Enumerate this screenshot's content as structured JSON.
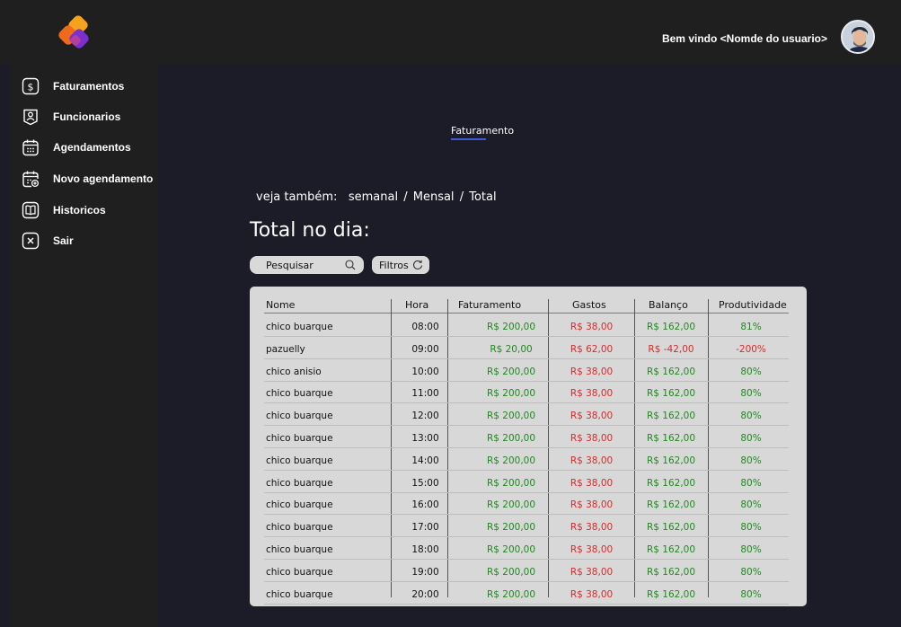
{
  "header": {
    "welcome": "Bem vindo <Nomde do usuario>"
  },
  "colors": {
    "background": "#1c1c28",
    "panel": "#1f1f1f",
    "accent": "#3d5bd9",
    "positive": "#1f8a1f",
    "negative": "#d62b2b",
    "logo_orange": "#f08a1c",
    "logo_purple": "#7b2fd1"
  },
  "sidebar": {
    "items": [
      {
        "label": "Faturamentos",
        "icon": "dollar-icon"
      },
      {
        "label": "Funcionarios",
        "icon": "user-badge-icon"
      },
      {
        "label": "Agendamentos",
        "icon": "calendar-icon"
      },
      {
        "label": "Novo agendamento",
        "icon": "calendar-add-icon"
      },
      {
        "label": "Historicos",
        "icon": "book-icon"
      },
      {
        "label": "Sair",
        "icon": "close-icon"
      }
    ]
  },
  "tabs": {
    "active": "Faturamento"
  },
  "see_also": {
    "prefix": "veja também:",
    "links": [
      "semanal",
      "Mensal",
      "Total"
    ],
    "separator": "/"
  },
  "main": {
    "title": "Total no dia:"
  },
  "search": {
    "placeholder": "Pesquisar"
  },
  "filters": {
    "label": "Filtros"
  },
  "table": {
    "headers": [
      "Nome",
      "Hora",
      "Faturamento",
      "Gastos",
      "Balanço",
      "Produtividade"
    ],
    "rows": [
      {
        "nome": "chico buarque",
        "hora": "08:00",
        "faturamento": "R$ 200,00",
        "gastos": "R$ 38,00",
        "balanco": "R$ 162,00",
        "produtividade": "81%"
      },
      {
        "nome": "pazuelly",
        "hora": "09:00",
        "faturamento": "R$ 20,00",
        "gastos": "R$ 62,00",
        "balanco": "R$ -42,00",
        "produtividade": "-200%"
      },
      {
        "nome": "chico anisio",
        "hora": "10:00",
        "faturamento": "R$ 200,00",
        "gastos": "R$ 38,00",
        "balanco": "R$ 162,00",
        "produtividade": "80%"
      },
      {
        "nome": "chico buarque",
        "hora": "11:00",
        "faturamento": "R$ 200,00",
        "gastos": "R$ 38,00",
        "balanco": "R$ 162,00",
        "produtividade": "80%"
      },
      {
        "nome": "chico buarque",
        "hora": "12:00",
        "faturamento": "R$ 200,00",
        "gastos": "R$ 38,00",
        "balanco": "R$ 162,00",
        "produtividade": "80%"
      },
      {
        "nome": "chico buarque",
        "hora": "13:00",
        "faturamento": "R$ 200,00",
        "gastos": "R$ 38,00",
        "balanco": "R$ 162,00",
        "produtividade": "80%"
      },
      {
        "nome": "chico buarque",
        "hora": "14:00",
        "faturamento": "R$ 200,00",
        "gastos": "R$ 38,00",
        "balanco": "R$ 162,00",
        "produtividade": "80%"
      },
      {
        "nome": "chico buarque",
        "hora": "15:00",
        "faturamento": "R$ 200,00",
        "gastos": "R$ 38,00",
        "balanco": "R$ 162,00",
        "produtividade": "80%"
      },
      {
        "nome": "chico buarque",
        "hora": "16:00",
        "faturamento": "R$ 200,00",
        "gastos": "R$ 38,00",
        "balanco": "R$ 162,00",
        "produtividade": "80%"
      },
      {
        "nome": "chico buarque",
        "hora": "17:00",
        "faturamento": "R$ 200,00",
        "gastos": "R$ 38,00",
        "balanco": "R$ 162,00",
        "produtividade": "80%"
      },
      {
        "nome": "chico buarque",
        "hora": "18:00",
        "faturamento": "R$ 200,00",
        "gastos": "R$ 38,00",
        "balanco": "R$ 162,00",
        "produtividade": "80%"
      },
      {
        "nome": "chico buarque",
        "hora": "19:00",
        "faturamento": "R$ 200,00",
        "gastos": "R$ 38,00",
        "balanco": "R$ 162,00",
        "produtividade": "80%"
      },
      {
        "nome": "chico buarque",
        "hora": "20:00",
        "faturamento": "R$ 200,00",
        "gastos": "R$ 38,00",
        "balanco": "R$ 162,00",
        "produtividade": "80%"
      }
    ]
  }
}
